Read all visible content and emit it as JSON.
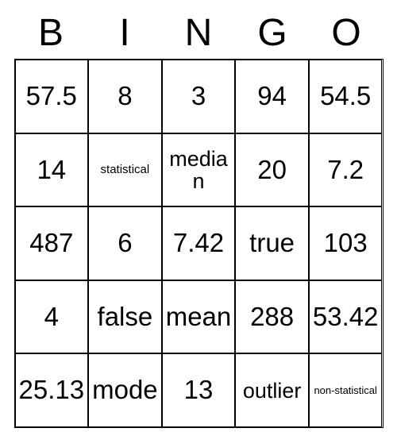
{
  "headers": [
    "B",
    "I",
    "N",
    "G",
    "O"
  ],
  "cells": [
    [
      {
        "text": "57.5",
        "size": "large"
      },
      {
        "text": "8",
        "size": "large"
      },
      {
        "text": "3",
        "size": "large"
      },
      {
        "text": "94",
        "size": "large"
      },
      {
        "text": "54.5",
        "size": "large"
      }
    ],
    [
      {
        "text": "14",
        "size": "large"
      },
      {
        "text": "statistical",
        "size": "small"
      },
      {
        "text": "median",
        "size": "med"
      },
      {
        "text": "20",
        "size": "large"
      },
      {
        "text": "7.2",
        "size": "large"
      }
    ],
    [
      {
        "text": "487",
        "size": "large"
      },
      {
        "text": "6",
        "size": "large"
      },
      {
        "text": "7.42",
        "size": "large"
      },
      {
        "text": "true",
        "size": "large"
      },
      {
        "text": "103",
        "size": "large"
      }
    ],
    [
      {
        "text": "4",
        "size": "large"
      },
      {
        "text": "false",
        "size": "large"
      },
      {
        "text": "mean",
        "size": "large"
      },
      {
        "text": "288",
        "size": "large"
      },
      {
        "text": "53.42",
        "size": "large"
      }
    ],
    [
      {
        "text": "25.13",
        "size": "large"
      },
      {
        "text": "mode",
        "size": "large"
      },
      {
        "text": "13",
        "size": "large"
      },
      {
        "text": "outlier",
        "size": "med"
      },
      {
        "text": "non-statistical",
        "size": "xsmall"
      }
    ]
  ]
}
